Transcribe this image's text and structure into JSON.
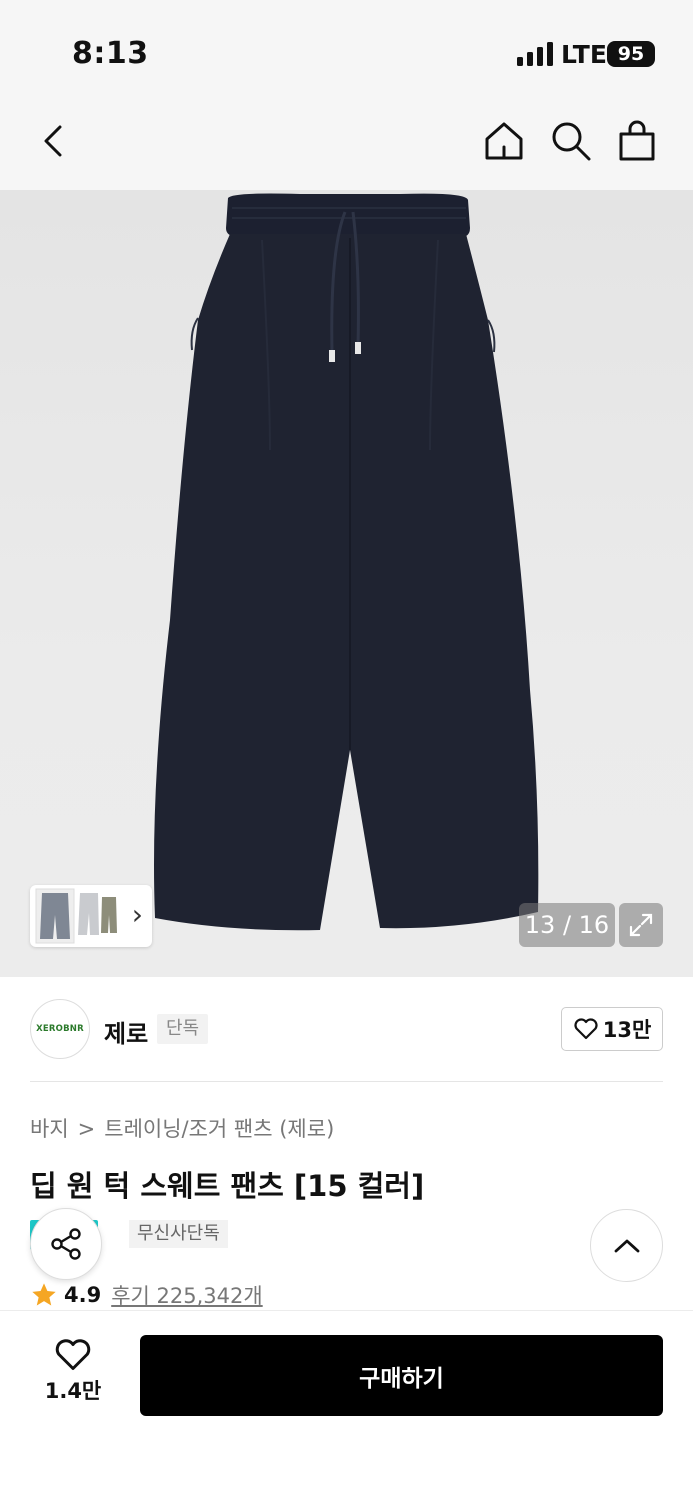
{
  "status_bar": {
    "time": "8:13",
    "network": "LTE",
    "battery": "95"
  },
  "nav": {
    "icons": [
      "back-arrow-icon",
      "home-icon",
      "search-icon",
      "shopping-bag-icon"
    ]
  },
  "gallery": {
    "counter": "13 / 16",
    "current_image": 13,
    "total_images": 16,
    "thumbnail_arrow": "›",
    "colors": {
      "pants": "#1f2331",
      "background": "#e8e8e8"
    }
  },
  "brand": {
    "logo_text": "XEROBNR",
    "name": "제로",
    "badge": "단독",
    "like_count": "13만"
  },
  "breadcrumb": {
    "parent": "바지",
    "separator": ">",
    "current": "트레이닝/조거 팬츠 (제로)"
  },
  "product": {
    "title": "딥 원 턱 스웨트 팬츠 [15 컬러]",
    "tag": "무신사단독",
    "tag_color": "#1ec8c8",
    "rating": "4.9",
    "reviews": "후기 225,342개",
    "star_color": "#f5a623"
  },
  "bottom_bar": {
    "wish_count": "1.4만",
    "buy_label": "구매하기"
  }
}
